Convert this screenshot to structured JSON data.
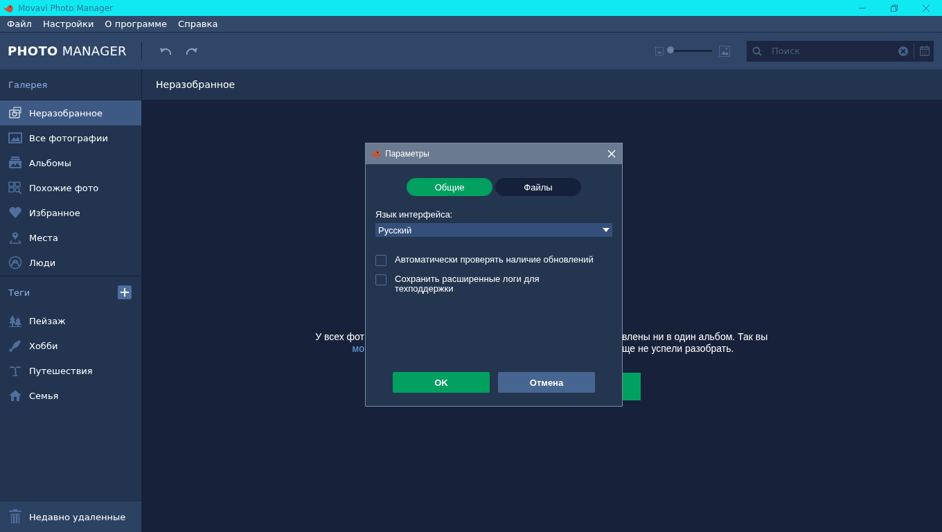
{
  "window": {
    "title": "Movavi Photo Manager"
  },
  "menu": [
    "Файл",
    "Настройки",
    "О программе",
    "Справка"
  ],
  "header": {
    "logo": "**PHOTO** MANAGER",
    "zoom_slider": {
      "level": 0
    },
    "search": {
      "placeholder": "Поиск"
    }
  },
  "sidebar": {
    "gallery_title": "Галерея",
    "items": [
      {
        "label": "Неразобранное",
        "kind": "camera",
        "selected": true
      },
      {
        "label": "Все фотографии",
        "kind": "photo",
        "selected": false
      },
      {
        "label": "Альбомы",
        "kind": "album",
        "selected": false
      },
      {
        "label": "Похожие фото",
        "kind": "similar",
        "selected": false
      },
      {
        "label": "Избранное",
        "kind": "heart",
        "selected": false
      },
      {
        "label": "Места",
        "kind": "pin",
        "selected": false
      },
      {
        "label": "Люди",
        "kind": "person",
        "selected": false
      }
    ],
    "tags_title": "Теги",
    "tags": [
      {
        "label": "Пейзаж",
        "kind": "trees",
        "selected": false
      },
      {
        "label": "Хобби",
        "kind": "shuttlecock",
        "selected": false
      },
      {
        "label": "Путешествия",
        "kind": "palm",
        "selected": false
      },
      {
        "label": "Семья",
        "kind": "house",
        "selected": false
      }
    ],
    "trash": {
      "label": "Недавно удаленные",
      "selected": false
    }
  },
  "content": {
    "title": "Неразобранное",
    "message_left": [
      "У всех фот",
      "мо"
    ],
    "message_right": [
      "влены ни в один альбом. Так вы",
      "ще не успели разобрать."
    ]
  },
  "dialog": {
    "title": "Параметры",
    "tabs": [
      {
        "label": "Общие",
        "selected": true
      },
      {
        "label": "Файлы",
        "selected": false
      }
    ],
    "language_label": "Язык интерфейса:",
    "language_value": "Русский",
    "options": [
      {
        "label": "Автоматически проверять наличие обновлений",
        "checked": false
      },
      {
        "label": "Сохранить расширенные логи для техподдержки",
        "checked": false
      }
    ],
    "buttons": [
      {
        "label": "OK",
        "kind": "primary"
      },
      {
        "label": "Отмена",
        "kind": "secondary"
      }
    ]
  }
}
